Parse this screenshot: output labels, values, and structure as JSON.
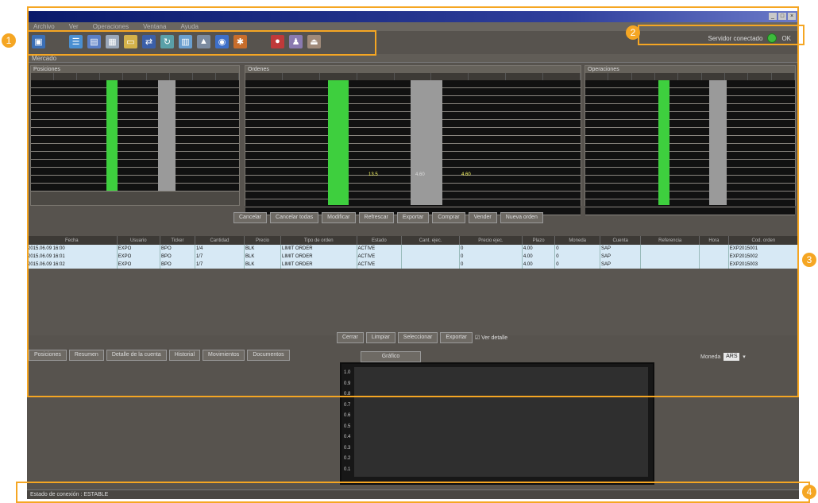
{
  "window": {
    "title": ""
  },
  "menu": [
    "Archivo",
    "Ver",
    "Operaciones",
    "Ventana",
    "Ayuda"
  ],
  "toolbar_icons": [
    "new-window-icon",
    "order-icon",
    "book-icon",
    "save-icon",
    "folder-icon",
    "trade-icon",
    "refresh-icon",
    "market-icon",
    "chart-icon",
    "web-icon",
    "settings-icon",
    "alert-icon",
    "user-icon",
    "logout-icon"
  ],
  "connection": {
    "label": "Servidor conectado",
    "status": "OK"
  },
  "tabs": {
    "active": "Mercado"
  },
  "panels": {
    "left": "Posiciones",
    "center": "Ordenes",
    "right": "Operaciones"
  },
  "center_values": {
    "row_a": "13.5",
    "row_b": "4.60",
    "row_c": "4.60"
  },
  "order_buttons": [
    "Cancelar",
    "Cancelar todas",
    "Modificar",
    "Refrescar",
    "Exportar",
    "Comprar",
    "Vender",
    "Nueva orden"
  ],
  "orders": {
    "columns": [
      "Fecha",
      "Usuario",
      "Ticker",
      "Cantidad",
      "Precio",
      "Tipo de orden",
      "Estado",
      "Cant. ejec.",
      "Precio ejec.",
      "Plazo",
      "Moneda",
      "Cuenta",
      "Referencia",
      "Hora",
      "Cod. orden"
    ],
    "rows": [
      [
        "2015.06.09 16:00",
        "EXPO",
        "BPO",
        "1/4",
        "BLK",
        "LIMIT ORDER",
        "ACTIVE",
        "",
        "0",
        "4.00",
        "0",
        "SAP",
        "",
        "",
        "EXP2015001"
      ],
      [
        "2015.06.09 16:01",
        "EXPO",
        "BPO",
        "1/7",
        "BLK",
        "LIMIT ORDER",
        "ACTIVE",
        "",
        "0",
        "4.00",
        "0",
        "SAP",
        "",
        "",
        "EXP2015002"
      ],
      [
        "2015.06.09 16:02",
        "EXPO",
        "BPO",
        "1/7",
        "BLK",
        "LIMIT ORDER",
        "ACTIVE",
        "",
        "0",
        "4.00",
        "0",
        "SAP",
        "",
        "",
        "EXP2015003"
      ]
    ]
  },
  "order_bottom_buttons": [
    "Cerrar",
    "Limpiar",
    "Seleccionar",
    "Exportar",
    "Ver detalle"
  ],
  "bottom_tabs": [
    "Posiciones",
    "Resumen",
    "Detalle de la cuenta",
    "Historial",
    "Movimientos",
    "Documentos"
  ],
  "chart_tab": "Gráfico",
  "chart_y_ticks": [
    "1.0",
    "0.9",
    "0.8",
    "0.7",
    "0.6",
    "0.5",
    "0.4",
    "0.3",
    "0.2",
    "0.1"
  ],
  "currency": {
    "label": "Moneda",
    "value": "ARS"
  },
  "status": {
    "text": "Estado de conexión : ESTABLE"
  },
  "callout_numbers": [
    "1",
    "2",
    "3",
    "4"
  ],
  "colors": {
    "accent": "#f5a623",
    "green": "#3ecf3e"
  }
}
